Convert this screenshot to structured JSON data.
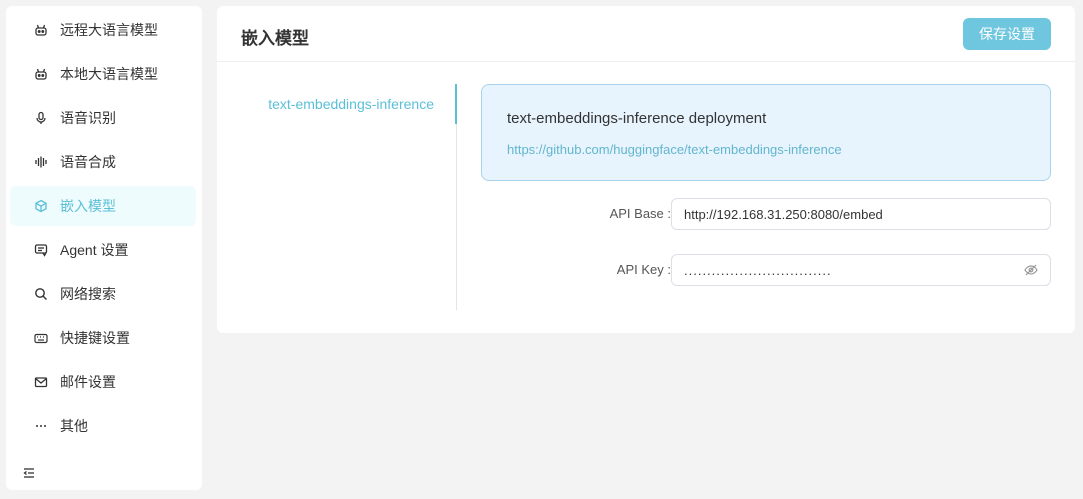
{
  "sidebar": {
    "items": [
      {
        "label": "远程大语言模型",
        "icon": "robot-icon",
        "active": false
      },
      {
        "label": "本地大语言模型",
        "icon": "robot-icon",
        "active": false
      },
      {
        "label": "语音识别",
        "icon": "microphone-icon",
        "active": false
      },
      {
        "label": "语音合成",
        "icon": "waveform-icon",
        "active": false
      },
      {
        "label": "嵌入模型",
        "icon": "cube-icon",
        "active": true
      },
      {
        "label": "Agent 设置",
        "icon": "agent-icon",
        "active": false
      },
      {
        "label": "网络搜索",
        "icon": "search-icon",
        "active": false
      },
      {
        "label": "快捷键设置",
        "icon": "keyboard-icon",
        "active": false
      },
      {
        "label": "邮件设置",
        "icon": "mail-icon",
        "active": false
      },
      {
        "label": "其他",
        "icon": "more-icon",
        "active": false
      }
    ],
    "collapse_icon": "collapse-menu-icon"
  },
  "header": {
    "title": "嵌入模型",
    "save_label": "保存设置"
  },
  "tabs": [
    {
      "label": "text-embeddings-inference",
      "active": true
    }
  ],
  "info": {
    "title": "text-embeddings-inference deployment",
    "link": "https://github.com/huggingface/text-embeddings-inference"
  },
  "form": {
    "api_base": {
      "label": "API Base :",
      "value": "http://192.168.31.250:8080/embed"
    },
    "api_key": {
      "label": "API Key :",
      "value": "................................",
      "icon": "eye-off-icon"
    }
  },
  "colors": {
    "accent": "#5bbfd8",
    "button": "#6ec6df",
    "info_bg": "#e8f4fd",
    "active_bg": "#effcfd"
  }
}
